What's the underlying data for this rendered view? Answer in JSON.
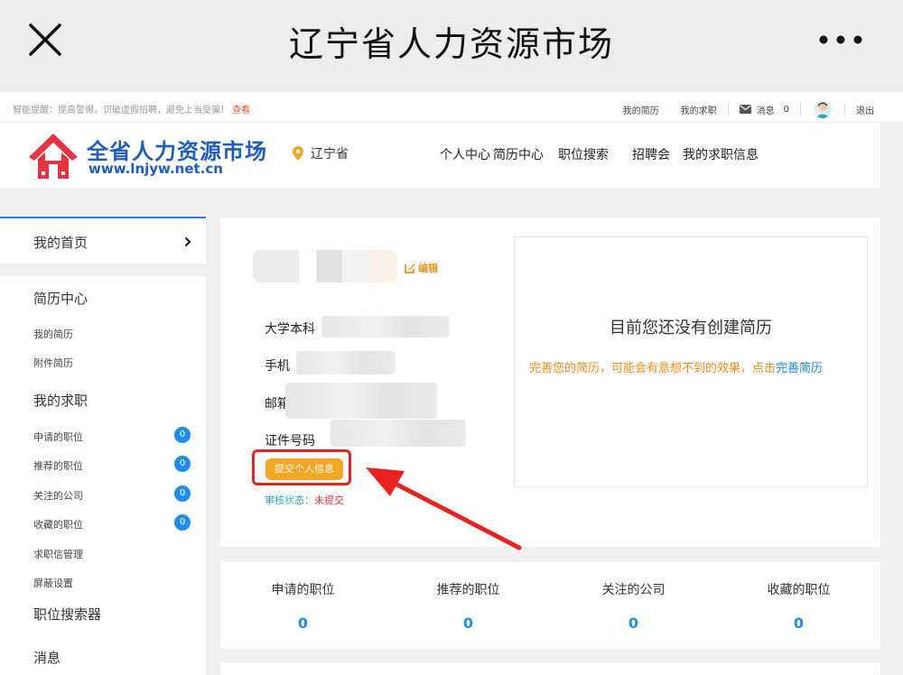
{
  "appbar": {
    "title": "辽宁省人力资源市场"
  },
  "topstrip": {
    "notice_prefix": "智能提醒：提高警惕，识破虚假招聘，避免上当受骗！",
    "notice_link": "查看",
    "my_resume": "我的简历",
    "my_job": "我的求职",
    "messages_label": "消息",
    "messages_count": "0",
    "logout": "退出"
  },
  "header": {
    "logo_name": "全省人力资源市场",
    "logo_url": "www.lnjyw.net.cn",
    "location": "辽宁省",
    "nav": [
      "个人中心",
      "简历中心",
      "职位搜索",
      "招聘会",
      "我的求职信息"
    ]
  },
  "sidebar": {
    "home": "我的首页",
    "resume_center": "简历中心",
    "my_resume": "我的简历",
    "attachment_resume": "附件简历",
    "my_job": "我的求职",
    "applied": {
      "label": "申请的职位",
      "count": "0"
    },
    "recommended": {
      "label": "推荐的职位",
      "count": "0"
    },
    "followed": {
      "label": "关注的公司",
      "count": "0"
    },
    "favorited": {
      "label": "收藏的职位",
      "count": "0"
    },
    "letter_manage": "求职信管理",
    "block_settings": "屏蔽设置",
    "job_searcher": "职位搜索器",
    "messages": "消息"
  },
  "profile": {
    "edit_label": "编辑",
    "education": "大学本科",
    "phone": "手机",
    "email": "邮箱",
    "id_number": "证件号码",
    "submit_label": "提交个人信息",
    "status_label": "审核状态：",
    "status_value": "未提交"
  },
  "resume_box": {
    "headline": "目前您还没有创建简历",
    "hint": "完善您的简历，可能会有意想不到的效果，点击",
    "hint_link": "完善简历"
  },
  "stats": [
    {
      "label": "申请的职位",
      "value": "0"
    },
    {
      "label": "推荐的职位",
      "value": "0"
    },
    {
      "label": "关注的公司",
      "value": "0"
    },
    {
      "label": "收藏的职位",
      "value": "0"
    }
  ],
  "colors": {
    "brand_blue": "#1d5cc4",
    "badge_blue": "#1e8ee8",
    "accent_orange": "#f5a623",
    "highlight_red": "#e8221f"
  }
}
